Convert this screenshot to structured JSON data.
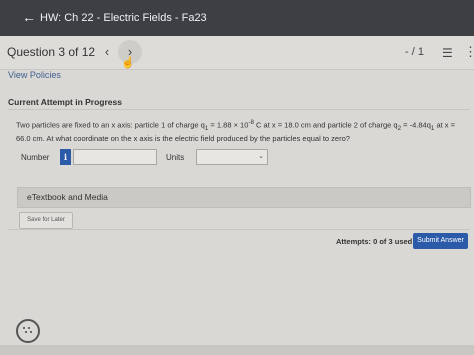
{
  "header": {
    "back_icon": "arrow-left-icon",
    "title": "HW: Ch 22 - Electric Fields - Fa23"
  },
  "question_nav": {
    "label": "Question 3 of 12",
    "prev_icon": "chevron-left-icon",
    "next_icon": "chevron-right-icon",
    "score": "- / 1",
    "list_icon": "list-icon",
    "menu_icon": "vertical-dots-icon"
  },
  "policies_link": "View Policies",
  "attempt_heading": "Current Attempt in Progress",
  "question": {
    "part1": "Two particles are fixed to an x axis: particle 1 of charge q",
    "sub1": "1",
    "part2": " = 1.88 × 10",
    "exp": "-8",
    "part3": " C at x = 18.0 cm and particle 2 of charge q",
    "sub2": "2",
    "part4": " = -4.84q",
    "sub3": "1",
    "part5": " at x = 66.0 cm. At what coordinate on the x axis is the electric field produced by the particles equal to zero?"
  },
  "answer": {
    "number_label": "Number",
    "info_icon": "i",
    "number_value": "",
    "units_label": "Units",
    "units_value": ""
  },
  "etextbook_label": "eTextbook and Media",
  "save_label": "Save for Later",
  "attempts_text": "Attempts: 0 of 3 used",
  "submit_label": "Submit Answer",
  "chat_icon": "chat-bubble-icon"
}
